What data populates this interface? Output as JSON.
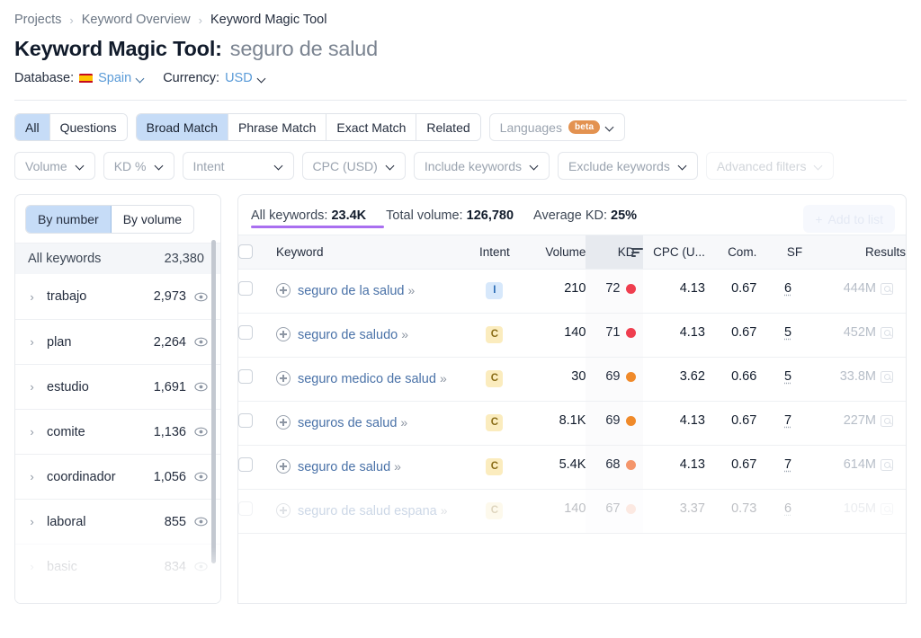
{
  "breadcrumb": {
    "items": [
      "Projects",
      "Keyword Overview",
      "Keyword Magic Tool"
    ],
    "separator": "›"
  },
  "title": {
    "main": "Keyword Magic Tool:",
    "query": "seguro de salud"
  },
  "meta": {
    "database_label": "Database:",
    "database_value": "Spain",
    "currency_label": "Currency:",
    "currency_value": "USD"
  },
  "tabs": {
    "group1": [
      {
        "label": "All",
        "active": true
      },
      {
        "label": "Questions",
        "active": false
      }
    ],
    "group2": [
      {
        "label": "Broad Match",
        "active": true
      },
      {
        "label": "Phrase Match",
        "active": false
      },
      {
        "label": "Exact Match",
        "active": false
      },
      {
        "label": "Related",
        "active": false
      }
    ],
    "languages": {
      "label": "Languages",
      "badge": "beta"
    }
  },
  "filters": [
    {
      "label": "Volume"
    },
    {
      "label": "KD %"
    },
    {
      "label": "Intent"
    },
    {
      "label": "CPC (USD)"
    },
    {
      "label": "Include keywords"
    },
    {
      "label": "Exclude keywords"
    },
    {
      "label": "Advanced filters",
      "faded": true
    }
  ],
  "sidebar": {
    "toggle": [
      {
        "label": "By number",
        "active": true
      },
      {
        "label": "By volume",
        "active": false
      }
    ],
    "all_label": "All keywords",
    "all_count": "23,380",
    "items": [
      {
        "name": "trabajo",
        "count": "2,973"
      },
      {
        "name": "plan",
        "count": "2,264"
      },
      {
        "name": "estudio",
        "count": "1,691"
      },
      {
        "name": "comite",
        "count": "1,136"
      },
      {
        "name": "coordinador",
        "count": "1,056"
      },
      {
        "name": "laboral",
        "count": "855"
      },
      {
        "name": "basic",
        "count": "834",
        "ghost": true
      }
    ]
  },
  "summary": {
    "all_keywords_label": "All keywords:",
    "all_keywords_value": "23.4K",
    "total_volume_label": "Total volume:",
    "total_volume_value": "126,780",
    "average_kd_label": "Average KD:",
    "average_kd_value": "25%",
    "add_to_list": "Add to list",
    "add_icon": "plus-icon",
    "underline_color": "#a96ff0"
  },
  "table": {
    "columns": {
      "keyword": "Keyword",
      "intent": "Intent",
      "volume": "Volume",
      "kd": "KD",
      "cpc": "CPC (U...",
      "com": "Com.",
      "sf": "SF",
      "results": "Results"
    },
    "sorted_by": "kd",
    "rows": [
      {
        "keyword": "seguro de la salud",
        "intent": "I",
        "volume": "210",
        "kd": "72",
        "kd_color": "#ef3e4f",
        "cpc": "4.13",
        "com": "0.67",
        "sf": "6",
        "results": "444M"
      },
      {
        "keyword": "seguro de saludo",
        "intent": "C",
        "volume": "140",
        "kd": "71",
        "kd_color": "#ef3e4f",
        "cpc": "4.13",
        "com": "0.67",
        "sf": "5",
        "results": "452M"
      },
      {
        "keyword": "seguro medico de salud",
        "intent": "C",
        "volume": "30",
        "kd": "69",
        "kd_color": "#f08a2a",
        "cpc": "3.62",
        "com": "0.66",
        "sf": "5",
        "results": "33.8M"
      },
      {
        "keyword": "seguros de salud",
        "intent": "C",
        "volume": "8.1K",
        "kd": "69",
        "kd_color": "#f08a2a",
        "cpc": "4.13",
        "com": "0.67",
        "sf": "7",
        "results": "227M"
      },
      {
        "keyword": "seguro de salud",
        "intent": "C",
        "volume": "5.4K",
        "kd": "68",
        "kd_color": "#f4956b",
        "cpc": "4.13",
        "com": "0.67",
        "sf": "7",
        "results": "614M"
      },
      {
        "keyword": "seguro de salud espana",
        "intent": "C",
        "volume": "140",
        "kd": "67",
        "kd_color": "#f6b39a",
        "cpc": "3.37",
        "com": "0.73",
        "sf": "6",
        "results": "105M",
        "ghost": true
      }
    ]
  }
}
